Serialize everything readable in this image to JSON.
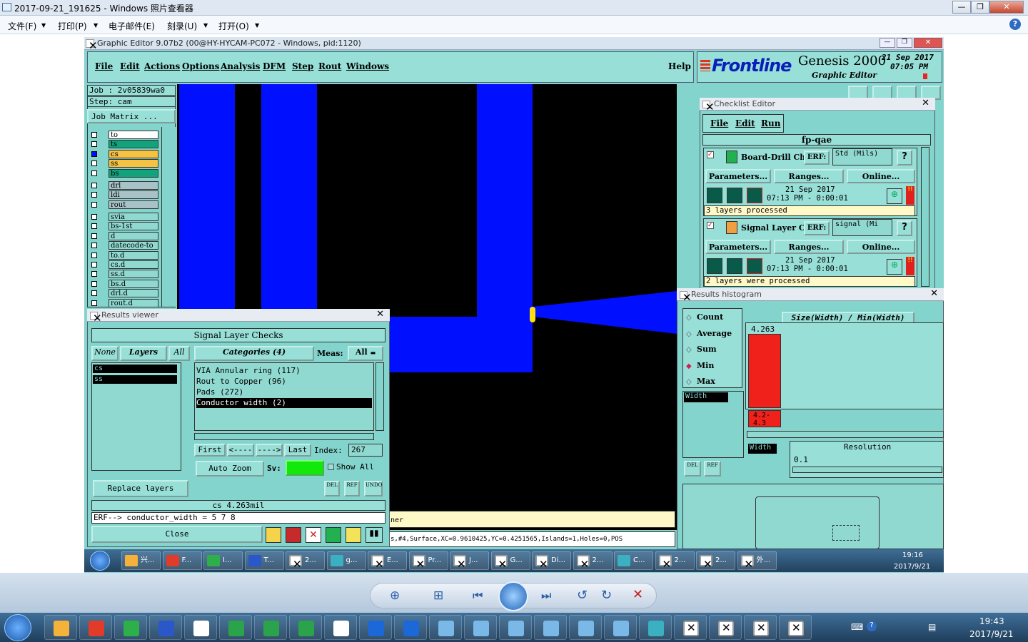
{
  "viewer": {
    "title": "2017-09-21_191625 - Windows 照片查看器",
    "menu": [
      "文件(F)",
      "打印(P)",
      "电子邮件(E)",
      "刻录(U)",
      "打开(O)"
    ],
    "controls": [
      "—",
      "❐",
      "✕"
    ]
  },
  "editor": {
    "title": "Graphic Editor 9.07b2 (00@HY-HYCAM-PC072 - Windows, pid:1120)",
    "menu": [
      "File",
      "Edit",
      "Actions",
      "Options",
      "Analysis",
      "DFM",
      "Step",
      "Rout",
      "Windows"
    ],
    "help": "Help",
    "logo": "Frontline",
    "product": "Genesis 2000",
    "product_sub": "Graphic Editor",
    "date": "21 Sep 2017",
    "time": "07:05 PM",
    "job": "Job : 2v05839wa0",
    "step": "Step: cam",
    "job_matrix": "Job Matrix ..."
  },
  "layers": [
    {
      "name": "to",
      "color": "#ffffff"
    },
    {
      "name": "ts",
      "color": "#13a37c"
    },
    {
      "name": "cs",
      "color": "#f5c242"
    },
    {
      "name": "ss",
      "color": "#f5c242"
    },
    {
      "name": "bs",
      "color": "#13a37c"
    },
    {
      "name": "drl",
      "color": "#a9c2c8"
    },
    {
      "name": "ldi",
      "color": "#a9c2c8"
    },
    {
      "name": "rout",
      "color": "#a9c2c8"
    },
    {
      "name": "svia",
      "color": "#8fd9d1"
    },
    {
      "name": "bs-1st",
      "color": "#8fd9d1"
    },
    {
      "name": "d",
      "color": "#8fd9d1"
    },
    {
      "name": "datecode-to",
      "color": "#8fd9d1"
    },
    {
      "name": "to.d",
      "color": "#8fd9d1"
    },
    {
      "name": "cs.d",
      "color": "#8fd9d1"
    },
    {
      "name": "ss.d",
      "color": "#8fd9d1"
    },
    {
      "name": "bs.d",
      "color": "#8fd9d1"
    },
    {
      "name": "drl.d",
      "color": "#8fd9d1"
    },
    {
      "name": "rout.d",
      "color": "#8fd9d1"
    }
  ],
  "results_viewer": {
    "title": "Results viewer",
    "heading": "Signal Layer Checks",
    "none": "None",
    "layers": "Layers",
    "all": "All",
    "layer_list": [
      "cs",
      "ss"
    ],
    "categories": "Categories (4)",
    "meas_label": "Meas:",
    "meas_value": "All",
    "category_items": [
      "VIA Annular ring (117)",
      "Rout to Copper (96)",
      "Pads (272)",
      "Conductor width (2)"
    ],
    "first": "First",
    "prev": "<----",
    "next": "---->",
    "last": "Last",
    "index_label": "Index:",
    "index_value": "267",
    "auto_zoom": "Auto Zoom",
    "sv_label": "Sv:",
    "show_all": "Show All",
    "replace_layers": "Replace layers",
    "result_value": "cs 4.263mil",
    "erf_line": "ERF--> conductor_width = 5 7 8",
    "close": "Close",
    "del": "DEL",
    "ref": "REF",
    "undo": "UNDO"
  },
  "status": {
    "line1": "ner",
    "line2": "s,#4,Surface,XC=0.9610425,YC=0.4251565,Islands=1,Holes=0,POS"
  },
  "checklist": {
    "title": "Checklist Editor",
    "menu": [
      "File",
      "Edit",
      "Run"
    ],
    "name": "fp-qae",
    "items": [
      {
        "name": "Board-Drill Che",
        "erf_label": "ERF:",
        "erf_value": "Std (Mils)",
        "buttons": [
          "Parameters...",
          "Ranges...",
          "Online..."
        ],
        "date": "21 Sep 2017",
        "time": "07:13 PM - 0:00:01",
        "status": "3 layers processed"
      },
      {
        "name": "Signal Layer Ch",
        "erf_label": "ERF:",
        "erf_value": "signal (Mi",
        "buttons": [
          "Parameters...",
          "Ranges...",
          "Online..."
        ],
        "date": "21 Sep 2017",
        "time": "07:13 PM - 0:00:01",
        "status": "2 layers were processed"
      }
    ]
  },
  "histogram": {
    "title": "Results histogram",
    "options": [
      "Count",
      "Average",
      "Sum",
      "Min",
      "Max"
    ],
    "selected": "Min",
    "measure": "Size(Width) / Min(Width)",
    "field": "Width",
    "field2": "Width",
    "bar_value": "4.263",
    "bar_label": "4.2-4.3",
    "resolution_label": "Resolution",
    "resolution_value": "0.1",
    "del": "DEL",
    "ref": "REF"
  },
  "inner_taskbar": {
    "items": [
      "兴...",
      "F...",
      "I...",
      "T...",
      "2...",
      "g...",
      "E...",
      "Pr...",
      "J...",
      "G...",
      "Di...",
      "2...",
      "C...",
      "2...",
      "2...",
      "外..."
    ],
    "time": "19:16",
    "date": "2017/9/21"
  },
  "main_taskbar": {
    "time": "19:43",
    "date": "2017/9/21"
  }
}
